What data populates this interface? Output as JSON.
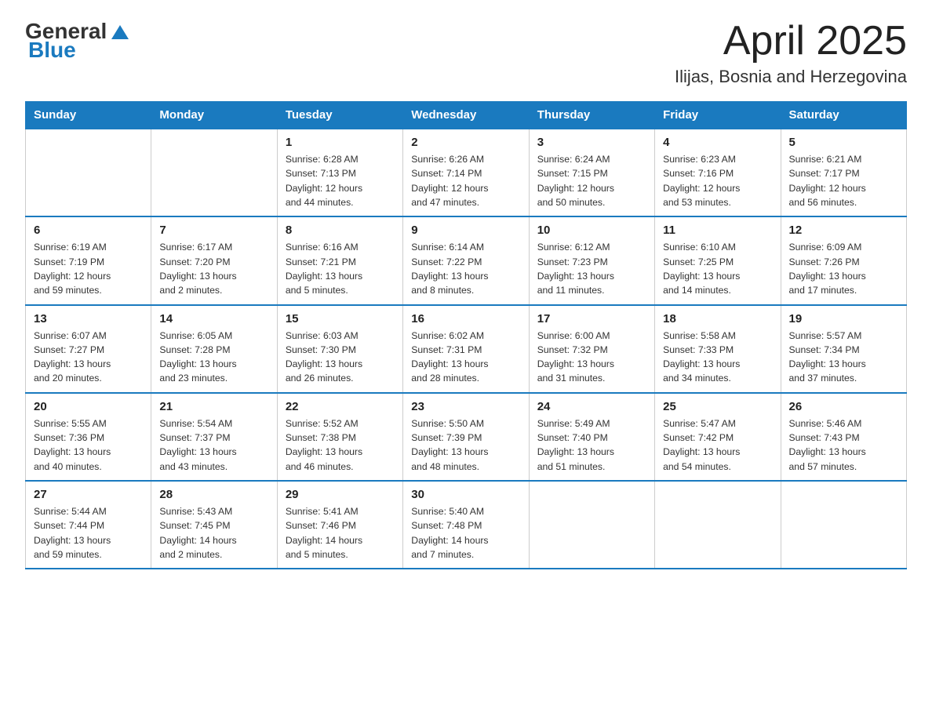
{
  "header": {
    "logo_general": "General",
    "logo_blue": "Blue",
    "month_year": "April 2025",
    "location": "Ilijas, Bosnia and Herzegovina"
  },
  "days_of_week": [
    "Sunday",
    "Monday",
    "Tuesday",
    "Wednesday",
    "Thursday",
    "Friday",
    "Saturday"
  ],
  "weeks": [
    [
      {
        "day": "",
        "info": ""
      },
      {
        "day": "",
        "info": ""
      },
      {
        "day": "1",
        "info": "Sunrise: 6:28 AM\nSunset: 7:13 PM\nDaylight: 12 hours\nand 44 minutes."
      },
      {
        "day": "2",
        "info": "Sunrise: 6:26 AM\nSunset: 7:14 PM\nDaylight: 12 hours\nand 47 minutes."
      },
      {
        "day": "3",
        "info": "Sunrise: 6:24 AM\nSunset: 7:15 PM\nDaylight: 12 hours\nand 50 minutes."
      },
      {
        "day": "4",
        "info": "Sunrise: 6:23 AM\nSunset: 7:16 PM\nDaylight: 12 hours\nand 53 minutes."
      },
      {
        "day": "5",
        "info": "Sunrise: 6:21 AM\nSunset: 7:17 PM\nDaylight: 12 hours\nand 56 minutes."
      }
    ],
    [
      {
        "day": "6",
        "info": "Sunrise: 6:19 AM\nSunset: 7:19 PM\nDaylight: 12 hours\nand 59 minutes."
      },
      {
        "day": "7",
        "info": "Sunrise: 6:17 AM\nSunset: 7:20 PM\nDaylight: 13 hours\nand 2 minutes."
      },
      {
        "day": "8",
        "info": "Sunrise: 6:16 AM\nSunset: 7:21 PM\nDaylight: 13 hours\nand 5 minutes."
      },
      {
        "day": "9",
        "info": "Sunrise: 6:14 AM\nSunset: 7:22 PM\nDaylight: 13 hours\nand 8 minutes."
      },
      {
        "day": "10",
        "info": "Sunrise: 6:12 AM\nSunset: 7:23 PM\nDaylight: 13 hours\nand 11 minutes."
      },
      {
        "day": "11",
        "info": "Sunrise: 6:10 AM\nSunset: 7:25 PM\nDaylight: 13 hours\nand 14 minutes."
      },
      {
        "day": "12",
        "info": "Sunrise: 6:09 AM\nSunset: 7:26 PM\nDaylight: 13 hours\nand 17 minutes."
      }
    ],
    [
      {
        "day": "13",
        "info": "Sunrise: 6:07 AM\nSunset: 7:27 PM\nDaylight: 13 hours\nand 20 minutes."
      },
      {
        "day": "14",
        "info": "Sunrise: 6:05 AM\nSunset: 7:28 PM\nDaylight: 13 hours\nand 23 minutes."
      },
      {
        "day": "15",
        "info": "Sunrise: 6:03 AM\nSunset: 7:30 PM\nDaylight: 13 hours\nand 26 minutes."
      },
      {
        "day": "16",
        "info": "Sunrise: 6:02 AM\nSunset: 7:31 PM\nDaylight: 13 hours\nand 28 minutes."
      },
      {
        "day": "17",
        "info": "Sunrise: 6:00 AM\nSunset: 7:32 PM\nDaylight: 13 hours\nand 31 minutes."
      },
      {
        "day": "18",
        "info": "Sunrise: 5:58 AM\nSunset: 7:33 PM\nDaylight: 13 hours\nand 34 minutes."
      },
      {
        "day": "19",
        "info": "Sunrise: 5:57 AM\nSunset: 7:34 PM\nDaylight: 13 hours\nand 37 minutes."
      }
    ],
    [
      {
        "day": "20",
        "info": "Sunrise: 5:55 AM\nSunset: 7:36 PM\nDaylight: 13 hours\nand 40 minutes."
      },
      {
        "day": "21",
        "info": "Sunrise: 5:54 AM\nSunset: 7:37 PM\nDaylight: 13 hours\nand 43 minutes."
      },
      {
        "day": "22",
        "info": "Sunrise: 5:52 AM\nSunset: 7:38 PM\nDaylight: 13 hours\nand 46 minutes."
      },
      {
        "day": "23",
        "info": "Sunrise: 5:50 AM\nSunset: 7:39 PM\nDaylight: 13 hours\nand 48 minutes."
      },
      {
        "day": "24",
        "info": "Sunrise: 5:49 AM\nSunset: 7:40 PM\nDaylight: 13 hours\nand 51 minutes."
      },
      {
        "day": "25",
        "info": "Sunrise: 5:47 AM\nSunset: 7:42 PM\nDaylight: 13 hours\nand 54 minutes."
      },
      {
        "day": "26",
        "info": "Sunrise: 5:46 AM\nSunset: 7:43 PM\nDaylight: 13 hours\nand 57 minutes."
      }
    ],
    [
      {
        "day": "27",
        "info": "Sunrise: 5:44 AM\nSunset: 7:44 PM\nDaylight: 13 hours\nand 59 minutes."
      },
      {
        "day": "28",
        "info": "Sunrise: 5:43 AM\nSunset: 7:45 PM\nDaylight: 14 hours\nand 2 minutes."
      },
      {
        "day": "29",
        "info": "Sunrise: 5:41 AM\nSunset: 7:46 PM\nDaylight: 14 hours\nand 5 minutes."
      },
      {
        "day": "30",
        "info": "Sunrise: 5:40 AM\nSunset: 7:48 PM\nDaylight: 14 hours\nand 7 minutes."
      },
      {
        "day": "",
        "info": ""
      },
      {
        "day": "",
        "info": ""
      },
      {
        "day": "",
        "info": ""
      }
    ]
  ]
}
